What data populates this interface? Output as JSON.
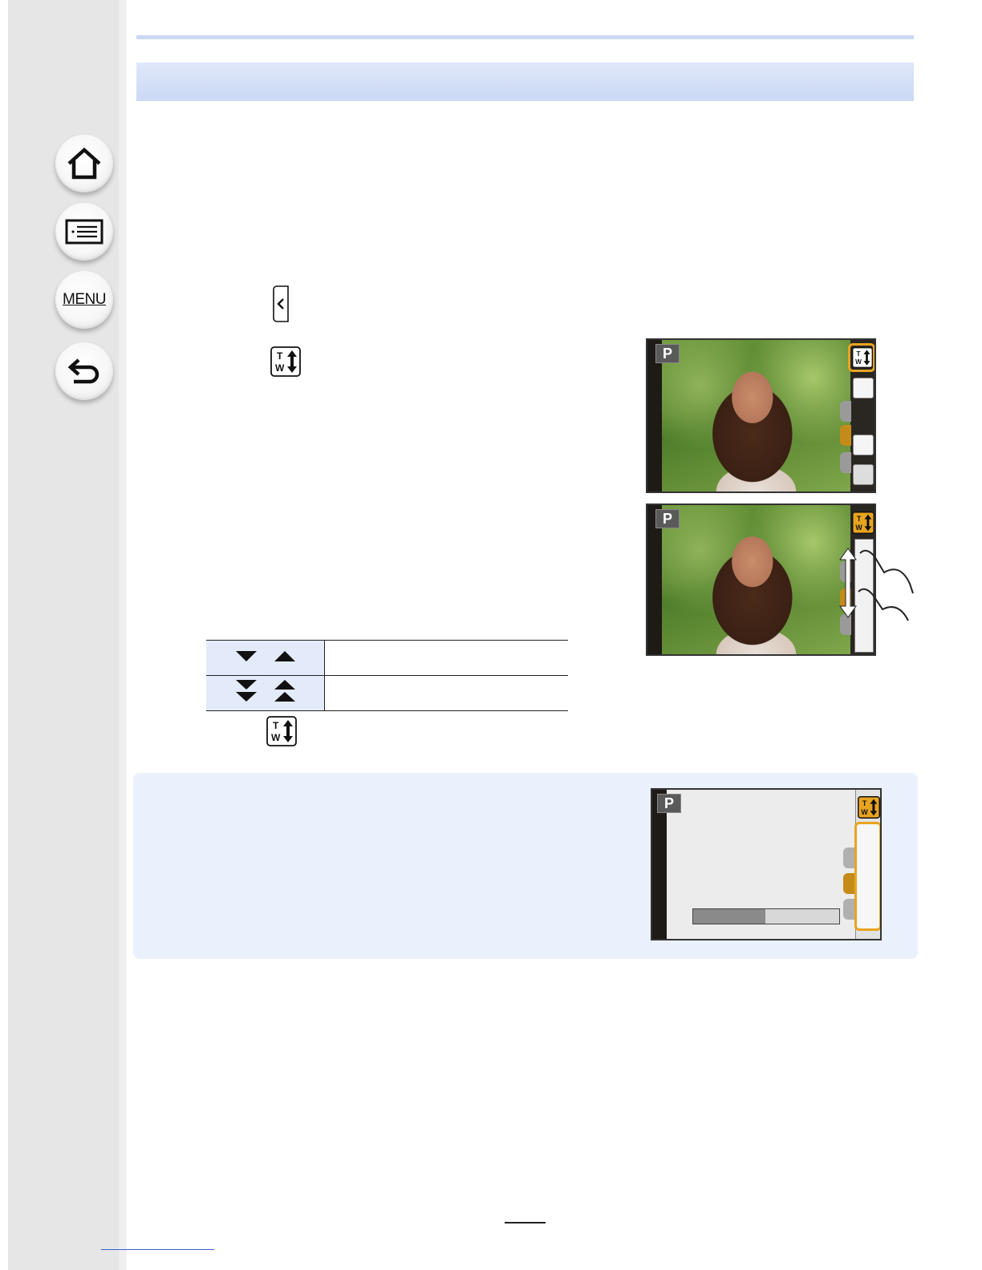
{
  "sidebar": {
    "buttons": [
      {
        "name": "home",
        "icon": "home-icon"
      },
      {
        "name": "contents",
        "icon": "list-icon"
      },
      {
        "name": "menu",
        "icon": "menu-text-icon",
        "label": "MENU"
      },
      {
        "name": "back",
        "icon": "back-arrow-icon"
      }
    ]
  },
  "inline_icons": [
    "tab-open-arrow-icon",
    "tw-zoom-icon",
    "tw-zoom-icon"
  ],
  "zoom_table": {
    "rows": [
      {
        "symbols": [
          "triangle-down-icon",
          "triangle-up-icon"
        ]
      },
      {
        "symbols": [
          "double-triangle-down-icon",
          "double-triangle-up-icon"
        ]
      }
    ]
  },
  "screens": [
    {
      "mode": "P",
      "highlighted_button": "tw-zoom-icon",
      "buttons": [
        "tw-zoom-icon",
        "touch-shutter-off-icon",
        "touch-ae-icon",
        "peak-icon"
      ],
      "tabs": [
        "effect-tab",
        "arrow-tab",
        "fn-tab"
      ]
    },
    {
      "mode": "P",
      "control": "zoom-slider",
      "gesture": "swipe-up-down"
    },
    {
      "mode": "P",
      "control": "zoom-slider-highlighted",
      "zoom_bar_ticks": 3
    }
  ],
  "colors": {
    "accent": "#e8a420",
    "band": "#cbd9f5",
    "info_bg": "#eaf1fc",
    "table_key_bg": "#e3ebfa"
  }
}
